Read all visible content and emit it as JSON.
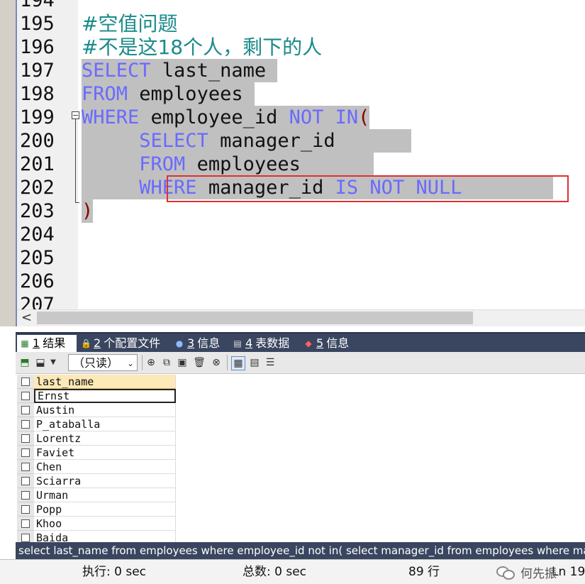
{
  "editor": {
    "line_numbers": [
      "194",
      "195",
      "196",
      "197",
      "198",
      "199",
      "200",
      "201",
      "202",
      "203",
      "204",
      "205",
      "206",
      "207"
    ],
    "lines": {
      "l195": "#空值问题",
      "l196": "#不是这18个人，剩下的人",
      "l197_kw": "SELECT",
      "l197_rest": " last_name ",
      "l198_kw": "FROM",
      "l198_rest": " employees ",
      "l199_kw1": "WHERE",
      "l199_mid": " employee_id ",
      "l199_kw2": "NOT",
      "l199_sp": " ",
      "l199_kw3": "IN",
      "l199_paren": "(",
      "l200_kw": "SELECT",
      "l200_rest": " manager_id ",
      "l201_kw": "FROM",
      "l201_rest": " employees ",
      "l202_kw": "WHERE",
      "l202_mid": " manager_id ",
      "l202_kw2": "IS",
      "l202_sp": " ",
      "l202_kw3": "NOT",
      "l202_sp2": " ",
      "l202_kw4": "NULL",
      "l203_paren": ")"
    },
    "scroll_left_glyph": "<"
  },
  "tabs": [
    {
      "num": "1",
      "label": "结果",
      "icon": "grid-result-icon"
    },
    {
      "num": "2",
      "label": "个配置文件",
      "icon": "profile-icon"
    },
    {
      "num": "3",
      "label": "信息",
      "icon": "info-icon"
    },
    {
      "num": "4",
      "label": "表数据",
      "icon": "table-data-icon"
    },
    {
      "num": "5",
      "label": "信息",
      "icon": "info-colored-icon"
    }
  ],
  "toolbar": {
    "readonly_value": "（只读）"
  },
  "grid": {
    "header": "last_name",
    "rows": [
      "Ernst",
      "Austin",
      "P_ataballa",
      "Lorentz",
      "Faviet",
      "Chen",
      "Sciarra",
      "Urman",
      "Popp",
      "Khoo",
      "Baida"
    ]
  },
  "sql_bar": "select last_name from employees where employee_id not in( select manager_id from employees where manager_id is not null)",
  "status": {
    "exec": "执行: 0 sec",
    "total": "总数: 0 sec",
    "rows": "89 行",
    "ln": "Ln 19"
  },
  "watermark": "何先振",
  "colors": {
    "keyword": "#6a6aff",
    "comment": "#1a8a8a",
    "selection": "#c0c0c0",
    "highlight_border": "#e03030",
    "panel_dark": "#3a4660"
  }
}
